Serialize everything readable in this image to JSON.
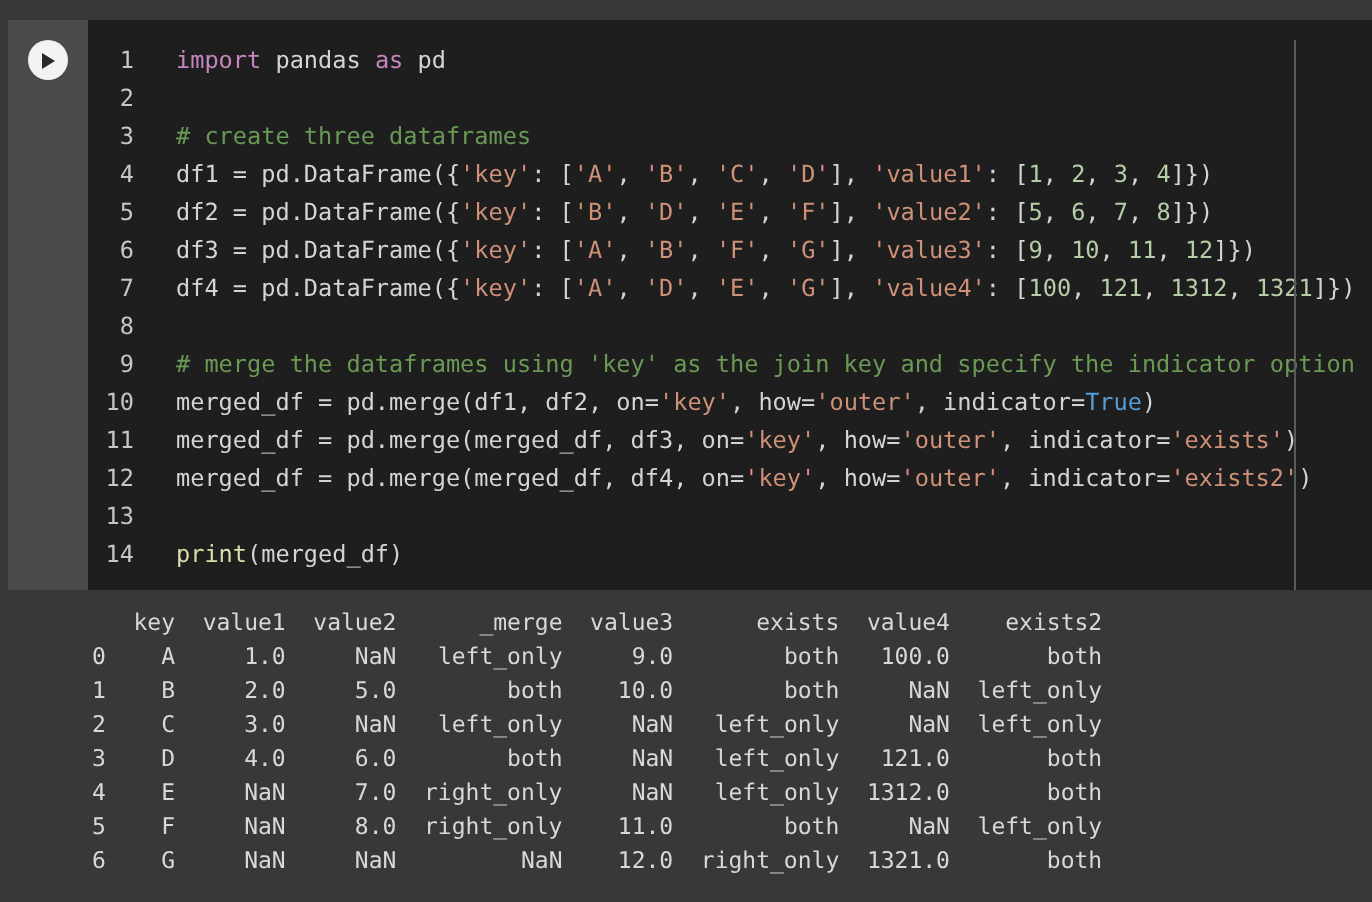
{
  "code_cell": {
    "lines": [
      {
        "number": "1",
        "tokens": [
          {
            "kind": "keyword",
            "text": "import"
          },
          {
            "kind": "plain",
            "text": " pandas "
          },
          {
            "kind": "keyword",
            "text": "as"
          },
          {
            "kind": "plain",
            "text": " pd"
          }
        ]
      },
      {
        "number": "2"
      },
      {
        "number": "3",
        "tokens": [
          {
            "kind": "comment",
            "text": "# create three dataframes"
          }
        ]
      },
      {
        "number": "4",
        "tokens": [
          {
            "kind": "plain",
            "text": "df1 = pd.DataFrame({"
          },
          {
            "kind": "string",
            "text": "'key'"
          },
          {
            "kind": "plain",
            "text": ": ["
          },
          {
            "kind": "string",
            "text": "'A'"
          },
          {
            "kind": "plain",
            "text": ", "
          },
          {
            "kind": "string",
            "text": "'B'"
          },
          {
            "kind": "plain",
            "text": ", "
          },
          {
            "kind": "string",
            "text": "'C'"
          },
          {
            "kind": "plain",
            "text": ", "
          },
          {
            "kind": "string",
            "text": "'D'"
          },
          {
            "kind": "plain",
            "text": "], "
          },
          {
            "kind": "string",
            "text": "'value1'"
          },
          {
            "kind": "plain",
            "text": ": ["
          },
          {
            "kind": "number",
            "text": "1"
          },
          {
            "kind": "plain",
            "text": ", "
          },
          {
            "kind": "number",
            "text": "2"
          },
          {
            "kind": "plain",
            "text": ", "
          },
          {
            "kind": "number",
            "text": "3"
          },
          {
            "kind": "plain",
            "text": ", "
          },
          {
            "kind": "number",
            "text": "4"
          },
          {
            "kind": "plain",
            "text": "]})"
          }
        ]
      },
      {
        "number": "5",
        "tokens": [
          {
            "kind": "plain",
            "text": "df2 = pd.DataFrame({"
          },
          {
            "kind": "string",
            "text": "'key'"
          },
          {
            "kind": "plain",
            "text": ": ["
          },
          {
            "kind": "string",
            "text": "'B'"
          },
          {
            "kind": "plain",
            "text": ", "
          },
          {
            "kind": "string",
            "text": "'D'"
          },
          {
            "kind": "plain",
            "text": ", "
          },
          {
            "kind": "string",
            "text": "'E'"
          },
          {
            "kind": "plain",
            "text": ", "
          },
          {
            "kind": "string",
            "text": "'F'"
          },
          {
            "kind": "plain",
            "text": "], "
          },
          {
            "kind": "string",
            "text": "'value2'"
          },
          {
            "kind": "plain",
            "text": ": ["
          },
          {
            "kind": "number",
            "text": "5"
          },
          {
            "kind": "plain",
            "text": ", "
          },
          {
            "kind": "number",
            "text": "6"
          },
          {
            "kind": "plain",
            "text": ", "
          },
          {
            "kind": "number",
            "text": "7"
          },
          {
            "kind": "plain",
            "text": ", "
          },
          {
            "kind": "number",
            "text": "8"
          },
          {
            "kind": "plain",
            "text": "]})"
          }
        ]
      },
      {
        "number": "6",
        "tokens": [
          {
            "kind": "plain",
            "text": "df3 = pd.DataFrame({"
          },
          {
            "kind": "string",
            "text": "'key'"
          },
          {
            "kind": "plain",
            "text": ": ["
          },
          {
            "kind": "string",
            "text": "'A'"
          },
          {
            "kind": "plain",
            "text": ", "
          },
          {
            "kind": "string",
            "text": "'B'"
          },
          {
            "kind": "plain",
            "text": ", "
          },
          {
            "kind": "string",
            "text": "'F'"
          },
          {
            "kind": "plain",
            "text": ", "
          },
          {
            "kind": "string",
            "text": "'G'"
          },
          {
            "kind": "plain",
            "text": "], "
          },
          {
            "kind": "string",
            "text": "'value3'"
          },
          {
            "kind": "plain",
            "text": ": ["
          },
          {
            "kind": "number",
            "text": "9"
          },
          {
            "kind": "plain",
            "text": ", "
          },
          {
            "kind": "number",
            "text": "10"
          },
          {
            "kind": "plain",
            "text": ", "
          },
          {
            "kind": "number",
            "text": "11"
          },
          {
            "kind": "plain",
            "text": ", "
          },
          {
            "kind": "number",
            "text": "12"
          },
          {
            "kind": "plain",
            "text": "]})"
          }
        ]
      },
      {
        "number": "7",
        "tokens": [
          {
            "kind": "plain",
            "text": "df4 = pd.DataFrame({"
          },
          {
            "kind": "string",
            "text": "'key'"
          },
          {
            "kind": "plain",
            "text": ": ["
          },
          {
            "kind": "string",
            "text": "'A'"
          },
          {
            "kind": "plain",
            "text": ", "
          },
          {
            "kind": "string",
            "text": "'D'"
          },
          {
            "kind": "plain",
            "text": ", "
          },
          {
            "kind": "string",
            "text": "'E'"
          },
          {
            "kind": "plain",
            "text": ", "
          },
          {
            "kind": "string",
            "text": "'G'"
          },
          {
            "kind": "plain",
            "text": "], "
          },
          {
            "kind": "string",
            "text": "'value4'"
          },
          {
            "kind": "plain",
            "text": ": ["
          },
          {
            "kind": "number",
            "text": "100"
          },
          {
            "kind": "plain",
            "text": ", "
          },
          {
            "kind": "number",
            "text": "121"
          },
          {
            "kind": "plain",
            "text": ", "
          },
          {
            "kind": "number",
            "text": "1312"
          },
          {
            "kind": "plain",
            "text": ", "
          },
          {
            "kind": "number",
            "text": "1321"
          },
          {
            "kind": "plain",
            "text": "]})"
          }
        ]
      },
      {
        "number": "8"
      },
      {
        "number": "9",
        "tokens": [
          {
            "kind": "comment",
            "text": "# merge the dataframes using 'key' as the join key and specify the indicator option"
          }
        ]
      },
      {
        "number": "10",
        "tokens": [
          {
            "kind": "plain",
            "text": "merged_df = pd.merge(df1, df2, on="
          },
          {
            "kind": "string",
            "text": "'key'"
          },
          {
            "kind": "plain",
            "text": ", how="
          },
          {
            "kind": "string",
            "text": "'outer'"
          },
          {
            "kind": "plain",
            "text": ", indicator="
          },
          {
            "kind": "constant",
            "text": "True"
          },
          {
            "kind": "plain",
            "text": ")"
          }
        ]
      },
      {
        "number": "11",
        "tokens": [
          {
            "kind": "plain",
            "text": "merged_df = pd.merge(merged_df, df3, on="
          },
          {
            "kind": "string",
            "text": "'key'"
          },
          {
            "kind": "plain",
            "text": ", how="
          },
          {
            "kind": "string",
            "text": "'outer'"
          },
          {
            "kind": "plain",
            "text": ", indicator="
          },
          {
            "kind": "string",
            "text": "'exists'"
          },
          {
            "kind": "plain",
            "text": ")"
          }
        ]
      },
      {
        "number": "12",
        "tokens": [
          {
            "kind": "plain",
            "text": "merged_df = pd.merge(merged_df, df4, on="
          },
          {
            "kind": "string",
            "text": "'key'"
          },
          {
            "kind": "plain",
            "text": ", how="
          },
          {
            "kind": "string",
            "text": "'outer'"
          },
          {
            "kind": "plain",
            "text": ", indicator="
          },
          {
            "kind": "string",
            "text": "'exists2'"
          },
          {
            "kind": "plain",
            "text": ")"
          }
        ]
      },
      {
        "number": "13"
      },
      {
        "number": "14",
        "tokens": [
          {
            "kind": "builtin",
            "text": "print"
          },
          {
            "kind": "plain",
            "text": "(merged_df)"
          }
        ]
      }
    ]
  },
  "output": {
    "columns": [
      "key",
      "value1",
      "value2",
      "_merge",
      "value3",
      "exists",
      "value4",
      "exists2"
    ],
    "rows": [
      {
        "index": "0",
        "cells": [
          "A",
          "1.0",
          "NaN",
          "left_only",
          "9.0",
          "both",
          "100.0",
          "both"
        ]
      },
      {
        "index": "1",
        "cells": [
          "B",
          "2.0",
          "5.0",
          "both",
          "10.0",
          "both",
          "NaN",
          "left_only"
        ]
      },
      {
        "index": "2",
        "cells": [
          "C",
          "3.0",
          "NaN",
          "left_only",
          "NaN",
          "left_only",
          "NaN",
          "left_only"
        ]
      },
      {
        "index": "3",
        "cells": [
          "D",
          "4.0",
          "6.0",
          "both",
          "NaN",
          "left_only",
          "121.0",
          "both"
        ]
      },
      {
        "index": "4",
        "cells": [
          "E",
          "NaN",
          "7.0",
          "right_only",
          "NaN",
          "left_only",
          "1312.0",
          "both"
        ]
      },
      {
        "index": "5",
        "cells": [
          "F",
          "NaN",
          "8.0",
          "right_only",
          "11.0",
          "both",
          "NaN",
          "left_only"
        ]
      },
      {
        "index": "6",
        "cells": [
          "G",
          "NaN",
          "NaN",
          "NaN",
          "12.0",
          "right_only",
          "1321.0",
          "both"
        ]
      }
    ]
  }
}
